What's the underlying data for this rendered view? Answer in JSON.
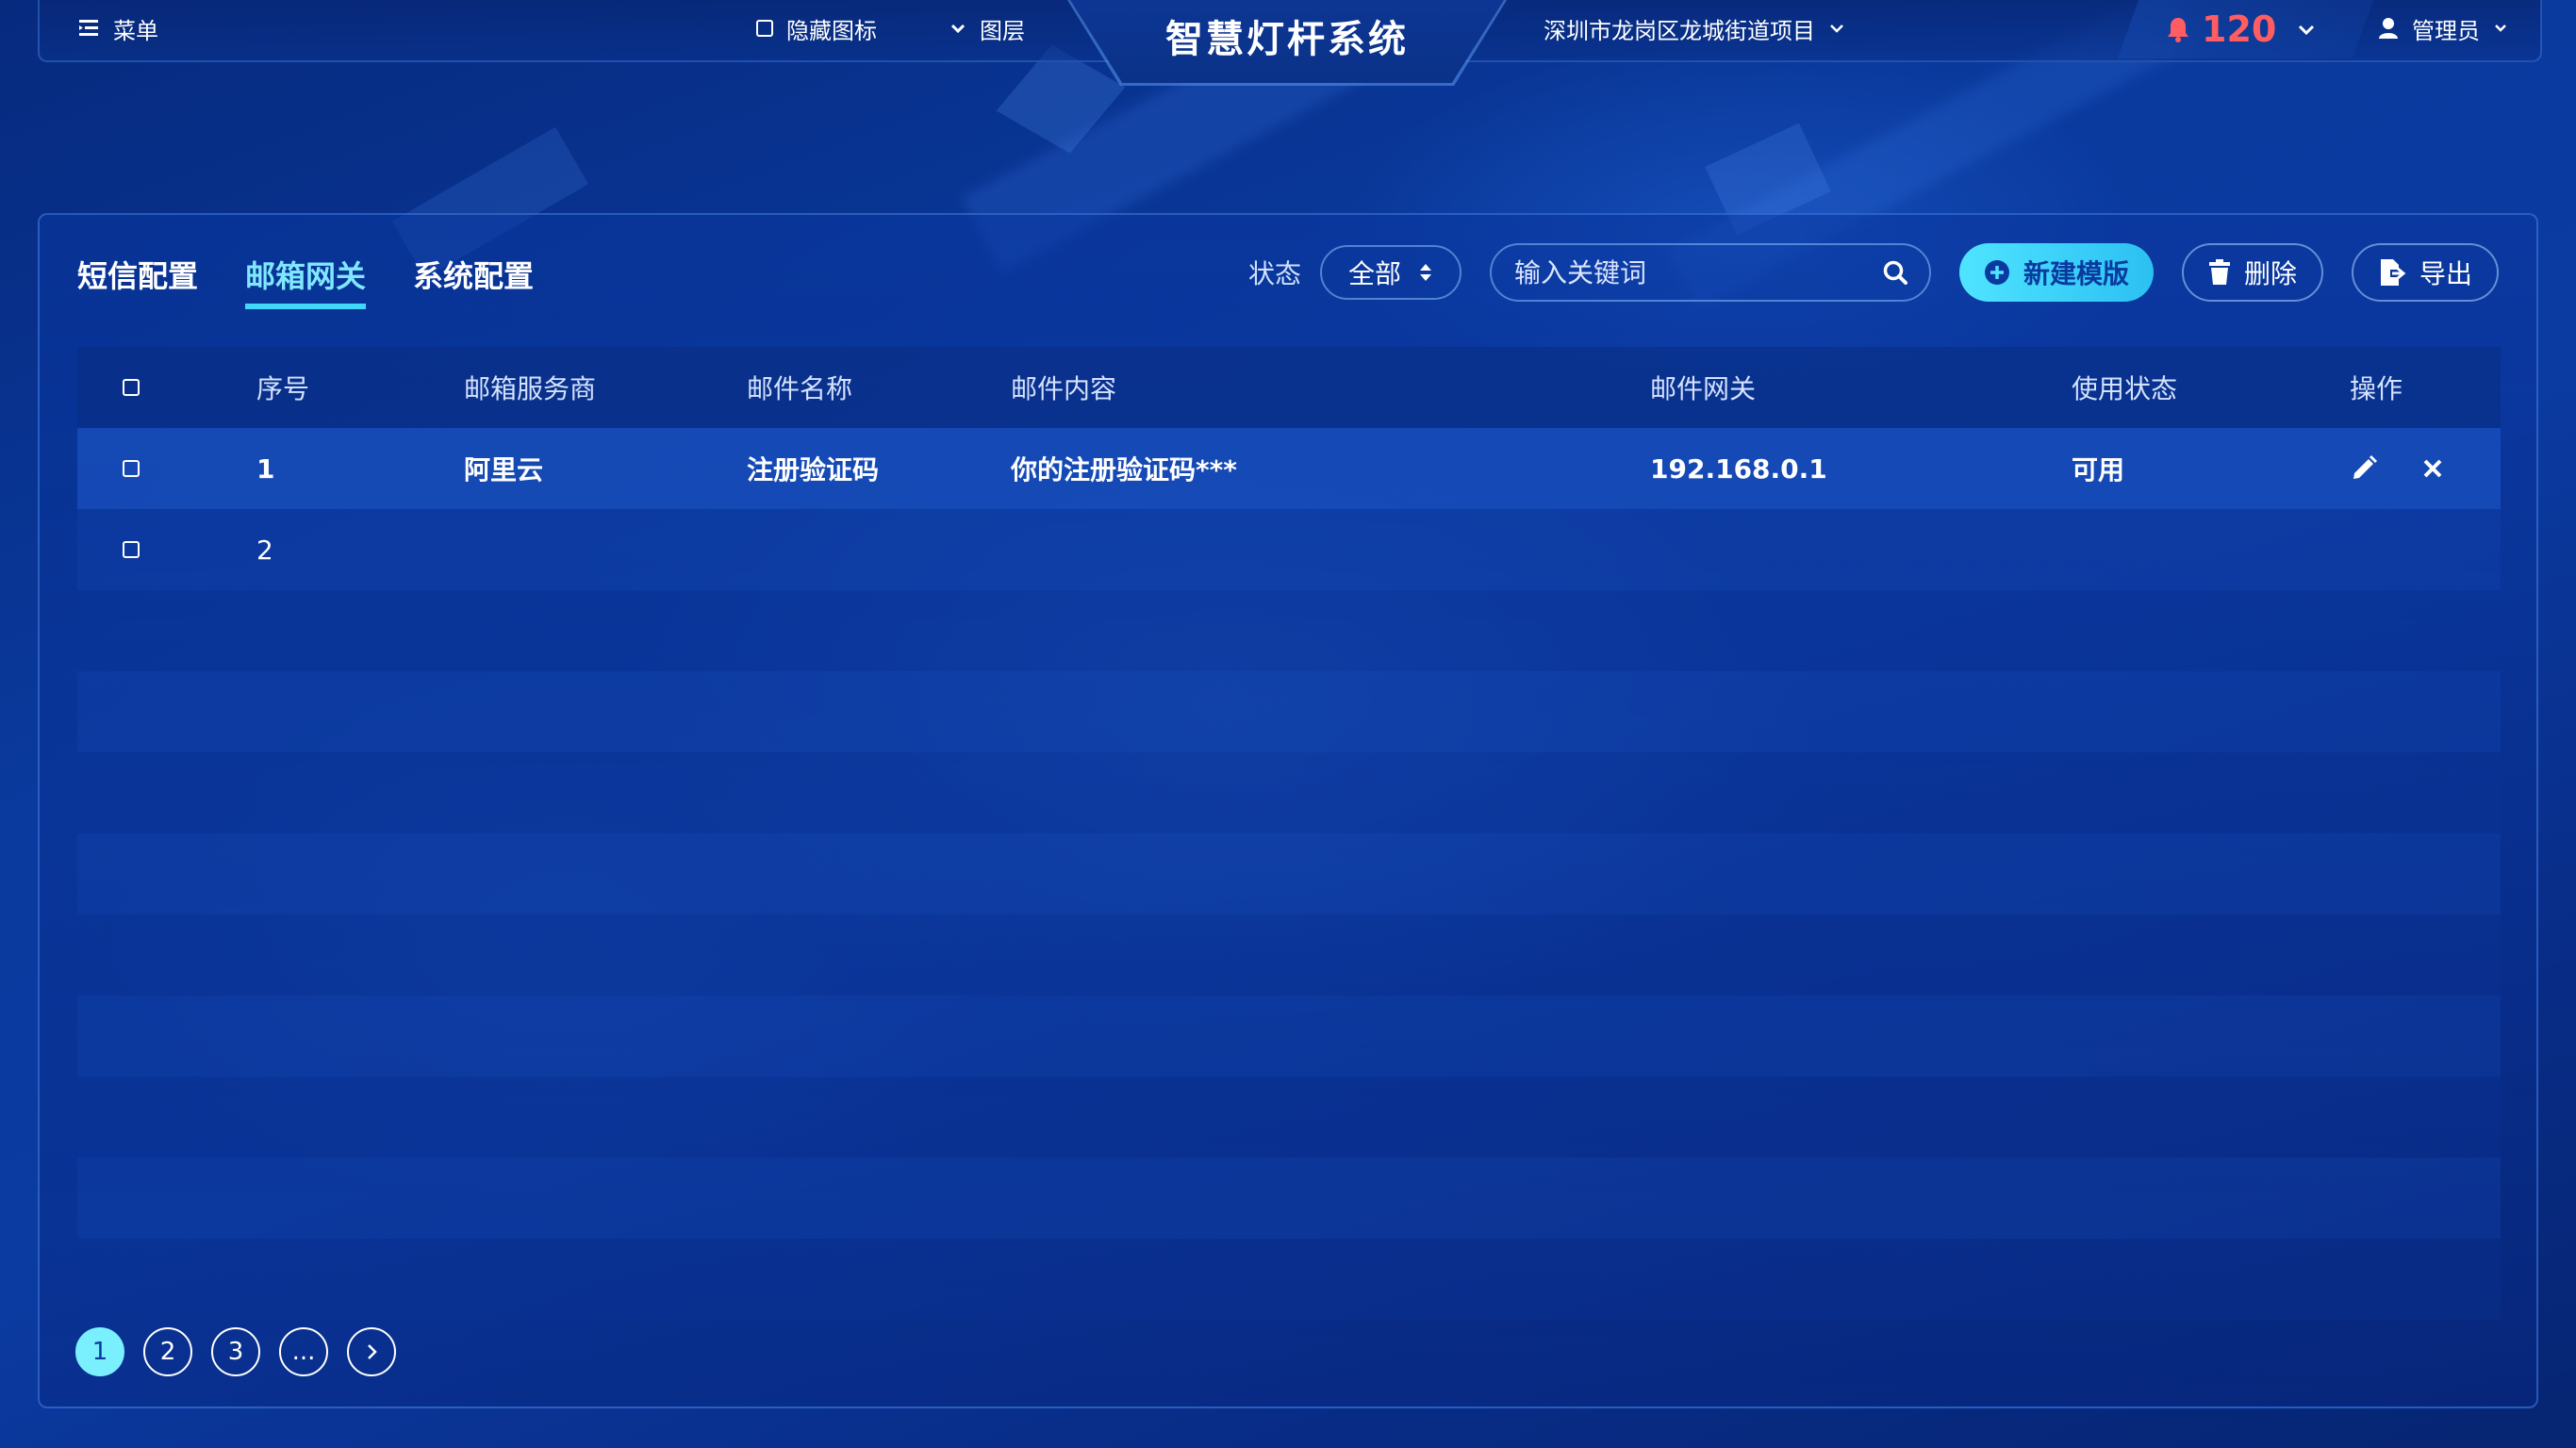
{
  "header": {
    "menu_label": "菜单",
    "hide_icons_label": "隐藏图标",
    "layers_label": "图层",
    "app_title": "智慧灯杆系统",
    "location": "深圳市龙岗区龙城街道项目",
    "alarm_count": "120",
    "user": "管理员"
  },
  "tabs": [
    {
      "label": "短信配置"
    },
    {
      "label": "邮箱网关"
    },
    {
      "label": "系统配置"
    }
  ],
  "toolbar": {
    "status_label": "状态",
    "status_value": "全部",
    "search_placeholder": "输入关键词",
    "new_template_label": "新建模版",
    "delete_label": "删除",
    "export_label": "导出"
  },
  "table": {
    "columns": {
      "index": "序号",
      "provider": "邮箱服务商",
      "mail_name": "邮件名称",
      "mail_content": "邮件内容",
      "gateway": "邮件网关",
      "status": "使用状态",
      "ops": "操作"
    },
    "rows": [
      {
        "index": "1",
        "provider": "阿里云",
        "mail_name": "注册验证码",
        "mail_content": "你的注册验证码***",
        "gateway": "192.168.0.1",
        "status": "可用"
      },
      {
        "index": "2",
        "provider": "",
        "mail_name": "",
        "mail_content": "",
        "gateway": "",
        "status": ""
      }
    ]
  },
  "pagination": {
    "pages": [
      "1",
      "2",
      "3",
      "..."
    ],
    "current": "1"
  },
  "colors": {
    "accent": "#3fd8f8",
    "alarm": "#ff5d62",
    "primary_button": "#4fe4ff"
  }
}
